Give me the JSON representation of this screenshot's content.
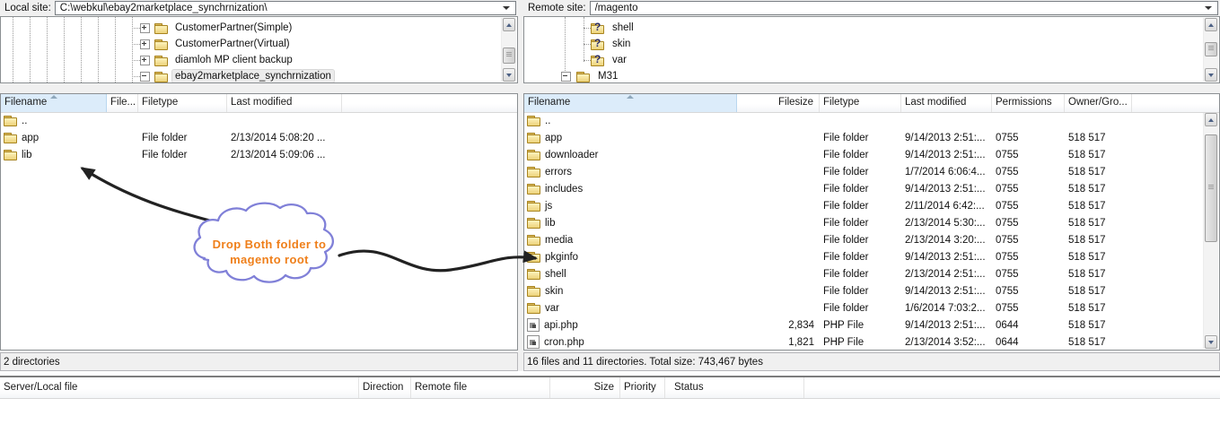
{
  "colors": {
    "sorted_header_bg": "#dcecfa",
    "folder_yellow": "#ecd27a",
    "annotation_text": "#ef7f1a",
    "annotation_cloud_border": "#8080d8",
    "arrow_black": "#222222",
    "toolbar_gray": "#f0f0f0"
  },
  "icons": {
    "question_folder_glyph": "?"
  },
  "local_site": {
    "label": "Local site:",
    "path": "C:\\webkul\\ebay2marketplace_synchrnization\\"
  },
  "remote_site": {
    "label": "Remote site:",
    "path": "/magento"
  },
  "local_tree": {
    "items": [
      {
        "label": "CustomerPartner(Simple)"
      },
      {
        "label": "CustomerPartner(Virtual)"
      },
      {
        "label": "diamloh MP client backup"
      },
      {
        "label": "ebay2marketplace_synchrnization"
      }
    ]
  },
  "remote_tree": {
    "items": [
      {
        "label": "shell"
      },
      {
        "label": "skin"
      },
      {
        "label": "var"
      },
      {
        "label": "M31"
      }
    ]
  },
  "local_list": {
    "headers": {
      "name": "Filename",
      "size": "File...",
      "type": "Filetype",
      "modified": "Last modified"
    },
    "rows": [
      {
        "name": "..",
        "type": "",
        "modified": ""
      },
      {
        "name": "app",
        "type": "File folder",
        "modified": "2/13/2014 5:08:20 ..."
      },
      {
        "name": "lib",
        "type": "File folder",
        "modified": "2/13/2014 5:09:06 ..."
      }
    ],
    "status": "2 directories"
  },
  "remote_list": {
    "headers": {
      "name": "Filename",
      "size": "Filesize",
      "type": "Filetype",
      "modified": "Last modified",
      "perms": "Permissions",
      "owner": "Owner/Gro..."
    },
    "rows": [
      {
        "name": "..",
        "size": "",
        "type": "",
        "modified": "",
        "perms": "",
        "owner": ""
      },
      {
        "name": "app",
        "size": "",
        "type": "File folder",
        "modified": "9/14/2013 2:51:...",
        "perms": "0755",
        "owner": "518 517"
      },
      {
        "name": "downloader",
        "size": "",
        "type": "File folder",
        "modified": "9/14/2013 2:51:...",
        "perms": "0755",
        "owner": "518 517"
      },
      {
        "name": "errors",
        "size": "",
        "type": "File folder",
        "modified": "1/7/2014 6:06:4...",
        "perms": "0755",
        "owner": "518 517"
      },
      {
        "name": "includes",
        "size": "",
        "type": "File folder",
        "modified": "9/14/2013 2:51:...",
        "perms": "0755",
        "owner": "518 517"
      },
      {
        "name": "js",
        "size": "",
        "type": "File folder",
        "modified": "2/11/2014 6:42:...",
        "perms": "0755",
        "owner": "518 517"
      },
      {
        "name": "lib",
        "size": "",
        "type": "File folder",
        "modified": "2/13/2014 5:30:...",
        "perms": "0755",
        "owner": "518 517"
      },
      {
        "name": "media",
        "size": "",
        "type": "File folder",
        "modified": "2/13/2014 3:20:...",
        "perms": "0755",
        "owner": "518 517"
      },
      {
        "name": "pkginfo",
        "size": "",
        "type": "File folder",
        "modified": "9/14/2013 2:51:...",
        "perms": "0755",
        "owner": "518 517"
      },
      {
        "name": "shell",
        "size": "",
        "type": "File folder",
        "modified": "2/13/2014 2:51:...",
        "perms": "0755",
        "owner": "518 517"
      },
      {
        "name": "skin",
        "size": "",
        "type": "File folder",
        "modified": "9/14/2013 2:51:...",
        "perms": "0755",
        "owner": "518 517"
      },
      {
        "name": "var",
        "size": "",
        "type": "File folder",
        "modified": "1/6/2014 7:03:2...",
        "perms": "0755",
        "owner": "518 517"
      },
      {
        "name": "api.php",
        "size": "2,834",
        "type": "PHP File",
        "modified": "9/14/2013 2:51:...",
        "perms": "0644",
        "owner": "518 517"
      },
      {
        "name": "cron.php",
        "size": "1,821",
        "type": "PHP File",
        "modified": "2/13/2014 3:52:...",
        "perms": "0644",
        "owner": "518 517"
      }
    ],
    "status": "16 files and 11 directories. Total size: 743,467 bytes"
  },
  "queue": {
    "headers": {
      "local": "Server/Local file",
      "direction": "Direction",
      "remote": "Remote file",
      "size": "Size",
      "priority": "Priority",
      "status": "Status"
    }
  },
  "annotation": {
    "line1": "Drop Both folder to",
    "line2": "magento root"
  }
}
